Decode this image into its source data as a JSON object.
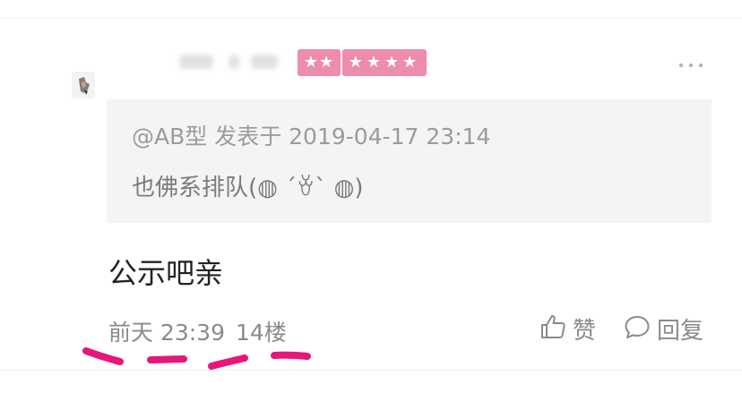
{
  "post": {
    "stars_left": "★★",
    "stars_right": "★★★★",
    "quote": {
      "meta": "@AB型 发表于 2019-04-17 23:14",
      "text": "也佛系排队(◍ ´ꈊ` ◍)"
    },
    "comment": "公示吧亲",
    "footer": {
      "time": "前天 23:39",
      "floor": "14楼"
    },
    "actions": {
      "like_label": "赞",
      "reply_label": "回复"
    }
  },
  "colors": {
    "badge_pink": "#ee8cab",
    "annotation_magenta": "#e6177a",
    "quote_bg": "#f4f4f4"
  },
  "icons": [
    "more-icon",
    "thumbs-up-icon",
    "comment-bubble-icon"
  ]
}
